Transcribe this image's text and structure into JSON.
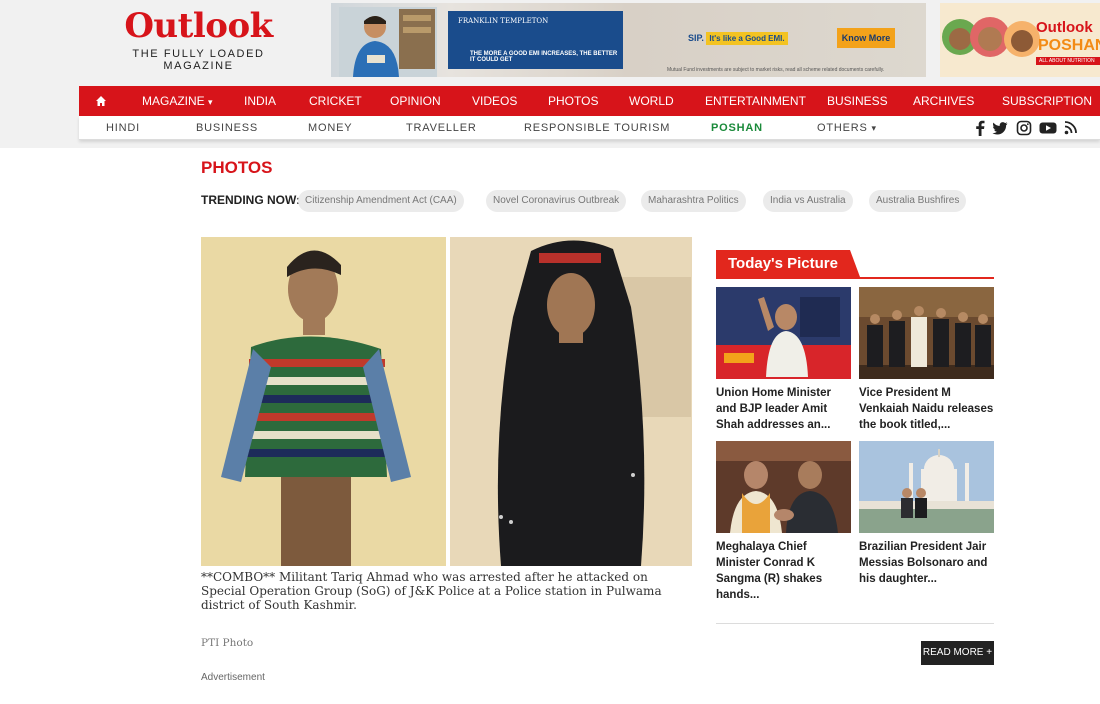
{
  "header": {
    "logo_text": "Outlook",
    "tagline": "THE FULLY LOADED MAGAZINE"
  },
  "ad_banner": {
    "brand": "FRANKLIN TEMPLETON",
    "tagline": "THE MORE A GOOD EMI INCREASES, THE BETTER IT COULD GET",
    "sip_label": "SIP.",
    "sip_highlight": "It's like a Good EMI.",
    "cta": "Know More",
    "disclaimer": "Mutual Fund investments are subject to market risks, read all scheme related documents carefully."
  },
  "ad_poshan": {
    "title": "Outlook",
    "subtitle": "POSHAN",
    "ribbon": "ALL ABOUT NUTRITION"
  },
  "nav_primary": {
    "home_icon": "home-icon",
    "items": [
      "MAGAZINE",
      "INDIA",
      "CRICKET",
      "OPINION",
      "VIDEOS",
      "PHOTOS",
      "WORLD",
      "ENTERTAINMENT",
      "BUSINESS",
      "ARCHIVES",
      "SUBSCRIPTION"
    ]
  },
  "nav_secondary": {
    "items": [
      "HINDI",
      "BUSINESS",
      "MONEY",
      "TRAVELLER",
      "RESPONSIBLE TOURISM",
      "POSHAN",
      "OTHERS"
    ],
    "social_icons": [
      "facebook-icon",
      "twitter-icon",
      "instagram-icon",
      "youtube-icon",
      "rss-icon"
    ]
  },
  "page": {
    "section_title": "PHOTOS",
    "trending_label": "TRENDING NOW:",
    "trending": [
      "Citizenship Amendment Act (CAA)",
      "Novel Coronavirus Outbreak",
      "Maharashtra Politics",
      "India vs Australia",
      "Australia Bushfires"
    ]
  },
  "main_photo": {
    "caption": "**COMBO** Militant Tariq Ahmad who was arrested after he attacked on Special Operation Group (SoG) of J&K Police at a Police station in Pulwama district of South Kashmir.",
    "credit": "PTI Photo",
    "advert_label": "Advertisement"
  },
  "todays_picture": {
    "heading": "Today's Picture",
    "cards": [
      {
        "caption": "Union Home Minister and BJP leader Amit Shah addresses an..."
      },
      {
        "caption": "Vice President M Venkaiah Naidu releases the book titled,..."
      },
      {
        "caption": "Meghalaya Chief Minister Conrad K Sangma (R) shakes hands..."
      },
      {
        "caption": "Brazilian President Jair Messias Bolsonaro and his daughter..."
      }
    ],
    "read_more": "READ MORE +"
  },
  "colors": {
    "brand_red": "#d7141a",
    "poshan_green": "#1a8a3a"
  }
}
